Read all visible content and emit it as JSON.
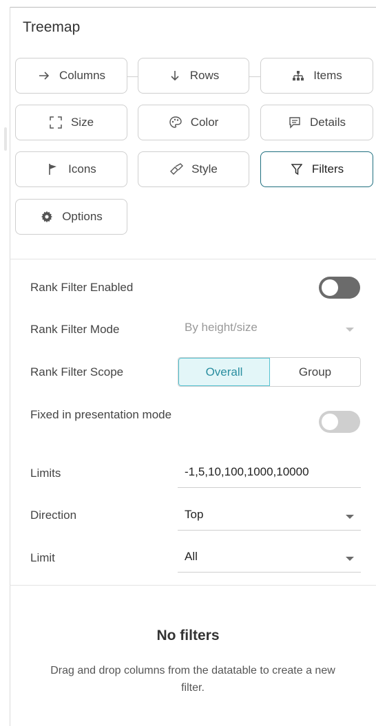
{
  "panel": {
    "title": "Treemap"
  },
  "buttons": {
    "columns": "Columns",
    "rows": "Rows",
    "items": "Items",
    "size": "Size",
    "color": "Color",
    "details": "Details",
    "icons": "Icons",
    "style": "Style",
    "filters": "Filters",
    "options": "Options"
  },
  "active_button": "Filters",
  "settings": {
    "rank_filter_enabled": {
      "label": "Rank Filter Enabled",
      "on": false
    },
    "rank_filter_mode": {
      "label": "Rank Filter Mode",
      "value": "By height/size",
      "disabled": true
    },
    "rank_filter_scope": {
      "label": "Rank Filter Scope",
      "options": [
        "Overall",
        "Group"
      ],
      "selected": "Overall"
    },
    "fixed_presentation": {
      "label": "Fixed in presentation mode",
      "on": false,
      "disabled": true
    },
    "limits": {
      "label": "Limits",
      "value": "-1,5,10,100,1000,10000"
    },
    "direction": {
      "label": "Direction",
      "value": "Top"
    },
    "limit": {
      "label": "Limit",
      "value": "All"
    }
  },
  "empty_state": {
    "title": "No filters",
    "description": "Drag and drop columns from the datatable to create a new filter."
  },
  "colors": {
    "accent": "#1e6e7e",
    "segment_selected": "#54c2d0",
    "toggle_off": "#6b6b6b"
  }
}
